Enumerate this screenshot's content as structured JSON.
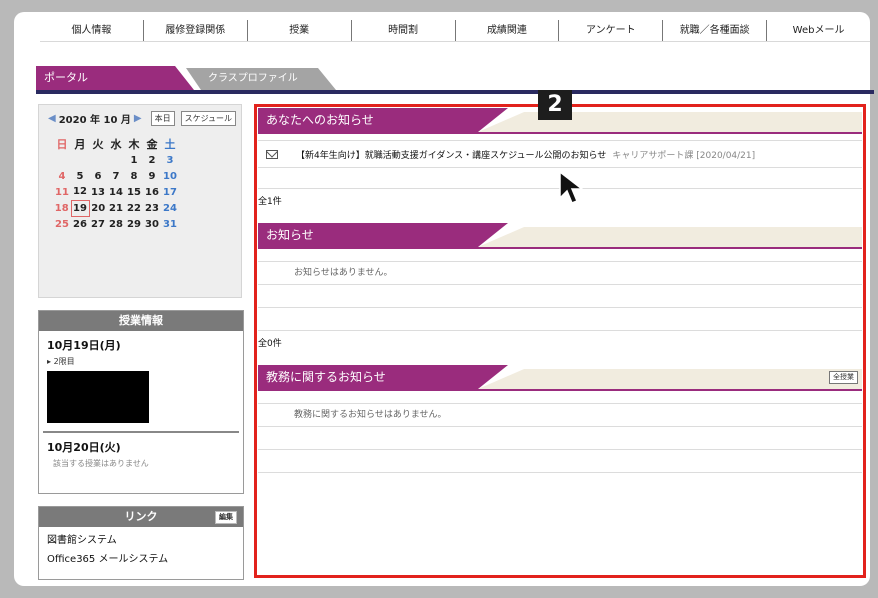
{
  "nav": [
    "個人情報",
    "履修登録関係",
    "授業",
    "時間割",
    "成績関連",
    "アンケート",
    "就職／各種面談",
    "Webメール"
  ],
  "tabs": {
    "active": "ポータル",
    "inactive": "クラスプロファイル"
  },
  "calendar": {
    "month_label": "2020 年 10 月",
    "today_button": "本日",
    "schedule_button": "スケジュール",
    "weekdays": [
      "日",
      "月",
      "火",
      "水",
      "木",
      "金",
      "土"
    ],
    "weeks": [
      [
        "",
        "",
        "",
        "",
        "1",
        "2",
        "3"
      ],
      [
        "4",
        "5",
        "6",
        "7",
        "8",
        "9",
        "10"
      ],
      [
        "11",
        "12",
        "13",
        "14",
        "15",
        "16",
        "17"
      ],
      [
        "18",
        "19",
        "20",
        "21",
        "22",
        "23",
        "24"
      ],
      [
        "25",
        "26",
        "27",
        "28",
        "29",
        "30",
        "31"
      ]
    ],
    "today": "19"
  },
  "class_info": {
    "title": "授業情報",
    "day1": "10月19日(月)",
    "day1_period": "2限目",
    "day2": "10月20日(火)",
    "day2_none": "該当する授業はありません"
  },
  "links": {
    "title": "リンク",
    "edit": "編集",
    "items": [
      "図書館システム",
      "Office365 メールシステム"
    ]
  },
  "sections": {
    "for_you": {
      "title": "あなたへのお知らせ",
      "notice_text": "【新4年生向け】就職活動支援ガイダンス・講座スケジュール公開のお知らせ",
      "notice_source": "キャリアサポート課 [2020/04/21]",
      "count": "全1件"
    },
    "notices": {
      "title": "お知らせ",
      "empty": "お知らせはありません。",
      "count": "全0件"
    },
    "academic": {
      "title": "教務に関するお知らせ",
      "all_button": "全授業",
      "empty": "教務に関するお知らせはありません。"
    }
  },
  "overlay": {
    "step": "2"
  },
  "colors": {
    "accent": "#9a2c7d",
    "highlight": "#e2221c"
  }
}
